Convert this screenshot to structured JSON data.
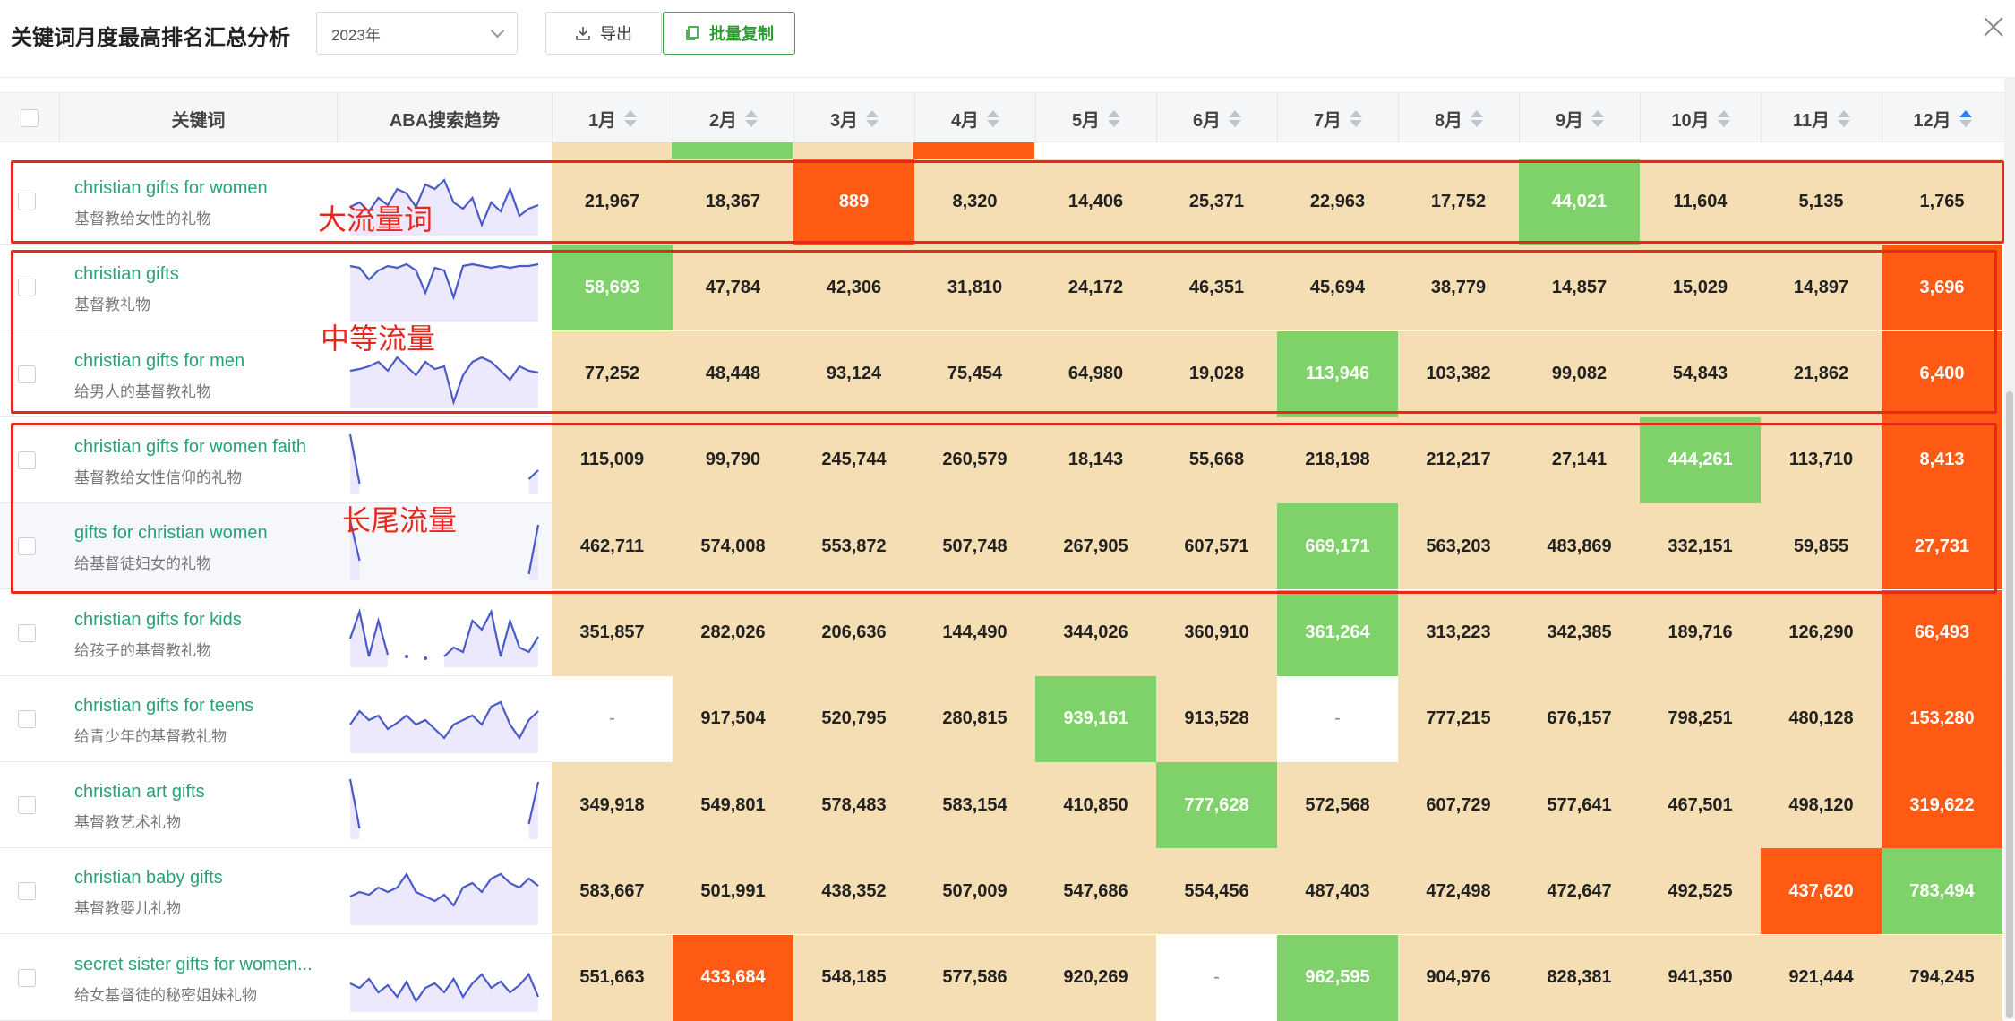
{
  "header": {
    "title": "关键词月度最高排名汇总分析",
    "year": "2023年",
    "export_label": "导出",
    "copy_label": "批量复制"
  },
  "columns": {
    "keyword": "关键词",
    "trend": "ABA搜索趋势",
    "months": [
      "1月",
      "2月",
      "3月",
      "4月",
      "5月",
      "6月",
      "7月",
      "8月",
      "9月",
      "10月",
      "11月",
      "12月"
    ],
    "active_sort": "12月"
  },
  "annotations": {
    "high": "大流量词",
    "medium": "中等流量",
    "long": "长尾流量"
  },
  "colors": {
    "tan": "#f5deb3",
    "green": "#7fd26a",
    "orange": "#ff5a14",
    "red_box": "#e8281d",
    "keyword": "#27a17a"
  },
  "rows": [
    {
      "en": "christian gifts for women",
      "cn": "基督教给女性的礼物",
      "values": [
        "21,967",
        "18,367",
        "889",
        "8,320",
        "14,406",
        "25,371",
        "22,963",
        "17,752",
        "44,021",
        "11,604",
        "5,135",
        "1,765"
      ],
      "colors": [
        "t",
        "t",
        "o",
        "t",
        "t",
        "t",
        "t",
        "t",
        "g",
        "t",
        "t",
        "t"
      ],
      "trend": [
        40,
        35,
        45,
        30,
        38,
        20,
        25,
        40,
        15,
        20,
        10,
        35,
        42,
        30,
        60,
        35,
        45,
        20,
        50,
        42,
        38
      ]
    },
    {
      "en": "christian gifts",
      "cn": "基督教礼物",
      "values": [
        "58,693",
        "47,784",
        "42,306",
        "31,810",
        "24,172",
        "46,351",
        "45,694",
        "38,779",
        "14,857",
        "15,029",
        "14,897",
        "3,696"
      ],
      "colors": [
        "g",
        "t",
        "t",
        "t",
        "t",
        "t",
        "t",
        "t",
        "t",
        "t",
        "t",
        "o"
      ],
      "trend": [
        10,
        12,
        25,
        15,
        10,
        12,
        8,
        15,
        40,
        12,
        15,
        45,
        10,
        8,
        10,
        12,
        10,
        12,
        10,
        10,
        8
      ]
    },
    {
      "en": "christian gifts for men",
      "cn": "给男人的基督教礼物",
      "values": [
        "77,252",
        "48,448",
        "93,124",
        "75,454",
        "64,980",
        "19,028",
        "113,946",
        "103,382",
        "99,082",
        "54,843",
        "21,862",
        "6,400"
      ],
      "colors": [
        "t",
        "t",
        "t",
        "t",
        "t",
        "t",
        "g",
        "t",
        "t",
        "t",
        "t",
        "o"
      ],
      "trend": [
        30,
        28,
        25,
        20,
        30,
        15,
        25,
        35,
        20,
        28,
        25,
        65,
        35,
        20,
        15,
        20,
        30,
        40,
        25,
        30,
        32
      ]
    },
    {
      "en": "christian gifts for women faith",
      "cn": "基督教给女性信仰的礼物",
      "values": [
        "115,009",
        "99,790",
        "245,744",
        "260,579",
        "18,143",
        "55,668",
        "218,198",
        "212,217",
        "27,141",
        "444,261",
        "113,710",
        "8,413"
      ],
      "colors": [
        "t",
        "t",
        "t",
        "t",
        "t",
        "t",
        "t",
        "t",
        "t",
        "g",
        "t",
        "o"
      ],
      "trend": [
        5,
        60,
        null,
        null,
        null,
        null,
        null,
        null,
        null,
        null,
        null,
        null,
        null,
        null,
        null,
        null,
        null,
        null,
        null,
        55,
        45
      ]
    },
    {
      "en": "gifts for christian women",
      "cn": "给基督徒妇女的礼物",
      "values": [
        "462,711",
        "574,008",
        "553,872",
        "507,748",
        "267,905",
        "607,571",
        "669,171",
        "563,203",
        "483,869",
        "332,151",
        "59,855",
        "27,731"
      ],
      "colors": [
        "t",
        "t",
        "t",
        "t",
        "t",
        "t",
        "g",
        "t",
        "t",
        "t",
        "t",
        "o"
      ],
      "trend": [
        5,
        50,
        null,
        null,
        null,
        null,
        null,
        null,
        null,
        null,
        null,
        null,
        null,
        null,
        null,
        null,
        null,
        null,
        null,
        65,
        10
      ]
    },
    {
      "en": "christian gifts for kids",
      "cn": "给孩子的基督教礼物",
      "values": [
        "351,857",
        "282,026",
        "206,636",
        "144,490",
        "344,026",
        "360,910",
        "361,264",
        "313,223",
        "342,385",
        "189,716",
        "126,290",
        "66,493"
      ],
      "colors": [
        "t",
        "t",
        "t",
        "t",
        "t",
        "t",
        "g",
        "t",
        "t",
        "t",
        "t",
        "o"
      ],
      "trend": [
        40,
        10,
        60,
        20,
        58,
        null,
        60,
        null,
        62,
        null,
        60,
        50,
        55,
        20,
        30,
        10,
        60,
        20,
        50,
        55,
        38
      ]
    },
    {
      "en": "christian gifts for teens",
      "cn": "给青少年的基督教礼物",
      "values": [
        "-",
        "917,504",
        "520,795",
        "280,815",
        "939,161",
        "913,528",
        "-",
        "777,215",
        "676,157",
        "798,251",
        "480,128",
        "153,280"
      ],
      "colors": [
        "w",
        "t",
        "t",
        "t",
        "g",
        "t",
        "w",
        "t",
        "t",
        "t",
        "t",
        "o"
      ],
      "trend": [
        40,
        25,
        35,
        30,
        45,
        38,
        30,
        40,
        35,
        45,
        55,
        40,
        35,
        30,
        40,
        20,
        15,
        40,
        55,
        35,
        25
      ]
    },
    {
      "en": "christian art gifts",
      "cn": "基督教艺术礼物",
      "values": [
        "349,918",
        "549,801",
        "578,483",
        "583,154",
        "410,850",
        "777,628",
        "572,568",
        "607,729",
        "577,641",
        "467,501",
        "498,120",
        "319,622"
      ],
      "colors": [
        "t",
        "t",
        "t",
        "t",
        "t",
        "g",
        "t",
        "t",
        "t",
        "t",
        "t",
        "o"
      ],
      "trend": [
        5,
        60,
        null,
        null,
        null,
        null,
        null,
        null,
        null,
        null,
        null,
        null,
        null,
        null,
        null,
        null,
        null,
        null,
        null,
        55,
        8
      ]
    },
    {
      "en": "christian baby gifts",
      "cn": "基督教婴儿礼物",
      "values": [
        "583,667",
        "501,991",
        "438,352",
        "507,009",
        "547,686",
        "554,456",
        "487,403",
        "472,498",
        "472,647",
        "492,525",
        "437,620",
        "783,494"
      ],
      "colors": [
        "t",
        "t",
        "t",
        "t",
        "t",
        "t",
        "t",
        "t",
        "t",
        "t",
        "o",
        "g"
      ],
      "trend": [
        40,
        35,
        38,
        30,
        35,
        30,
        15,
        35,
        40,
        45,
        38,
        50,
        30,
        25,
        35,
        20,
        15,
        25,
        30,
        20,
        28
      ]
    },
    {
      "en": "secret sister gifts for women...",
      "cn": "给女基督徒的秘密姐妹礼物",
      "values": [
        "551,663",
        "433,684",
        "548,185",
        "577,586",
        "920,269",
        "-",
        "962,595",
        "904,976",
        "828,381",
        "941,350",
        "921,444",
        "794,245"
      ],
      "colors": [
        "t",
        "o",
        "t",
        "t",
        "t",
        "w",
        "g",
        "t",
        "t",
        "t",
        "t",
        "t"
      ],
      "trend": [
        40,
        45,
        35,
        50,
        42,
        55,
        38,
        60,
        45,
        40,
        50,
        35,
        55,
        40,
        30,
        45,
        38,
        50,
        42,
        30,
        55
      ]
    }
  ]
}
